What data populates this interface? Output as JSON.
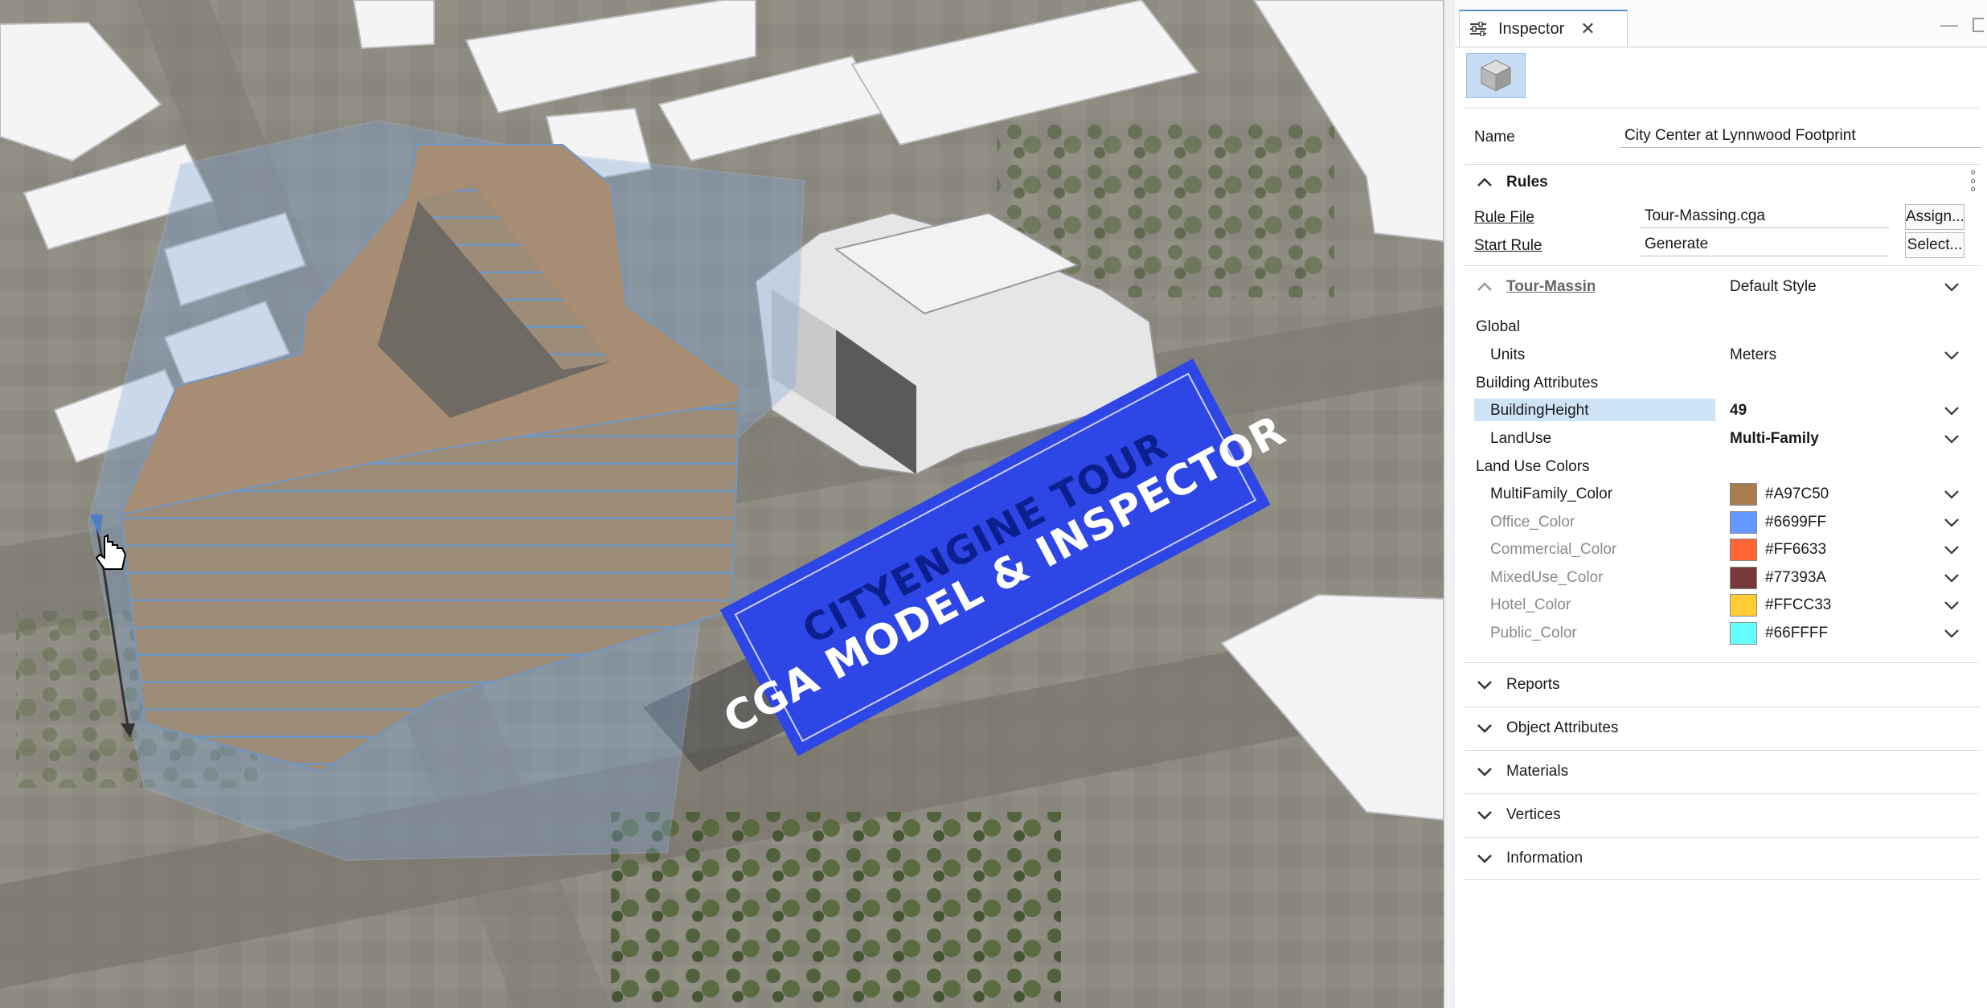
{
  "viewport": {
    "banner": {
      "line1": "CITYENGINE TOUR",
      "line2": "CGA MODEL & INSPECTOR"
    },
    "colors": {
      "ground": "#8d8a80",
      "building_roof": "#A97C50",
      "selection": "#7fa6d6",
      "banner": "#2e46e6"
    }
  },
  "inspector": {
    "tab_title": "Inspector",
    "name_label": "Name",
    "name_value": "City Center at Lynnwood Footprint",
    "rules": {
      "title": "Rules",
      "rule_file_label": "Rule File",
      "rule_file_value": "Tour-Massing.cga",
      "assign_button": "Assign...",
      "start_rule_label": "Start Rule",
      "start_rule_value": "Generate",
      "select_button": "Select..."
    },
    "style": {
      "label": "Tour-Massing",
      "value": "Default Style"
    },
    "global": {
      "title": "Global",
      "units_label": "Units",
      "units_value": "Meters"
    },
    "building_attributes": {
      "title": "Building Attributes",
      "height_label": "BuildingHeight",
      "height_value": "49",
      "landuse_label": "LandUse",
      "landuse_value": "Multi-Family"
    },
    "land_use_colors": {
      "title": "Land Use Colors",
      "items": [
        {
          "label": "MultiFamily_Color",
          "value": "#A97C50",
          "color": "#A97C50"
        },
        {
          "label": "Office_Color",
          "value": "#6699FF",
          "color": "#6699FF"
        },
        {
          "label": "Commercial_Color",
          "value": "#FF6633",
          "color": "#FF6633"
        },
        {
          "label": "MixedUse_Color",
          "value": "#77393A",
          "color": "#77393A"
        },
        {
          "label": "Hotel_Color",
          "value": "#FFCC33",
          "color": "#FFCC33"
        },
        {
          "label": "Public_Color",
          "value": "#66FFFF",
          "color": "#66FFFF"
        }
      ]
    },
    "collapsed_sections": [
      "Reports",
      "Object Attributes",
      "Materials",
      "Vertices",
      "Information"
    ]
  }
}
